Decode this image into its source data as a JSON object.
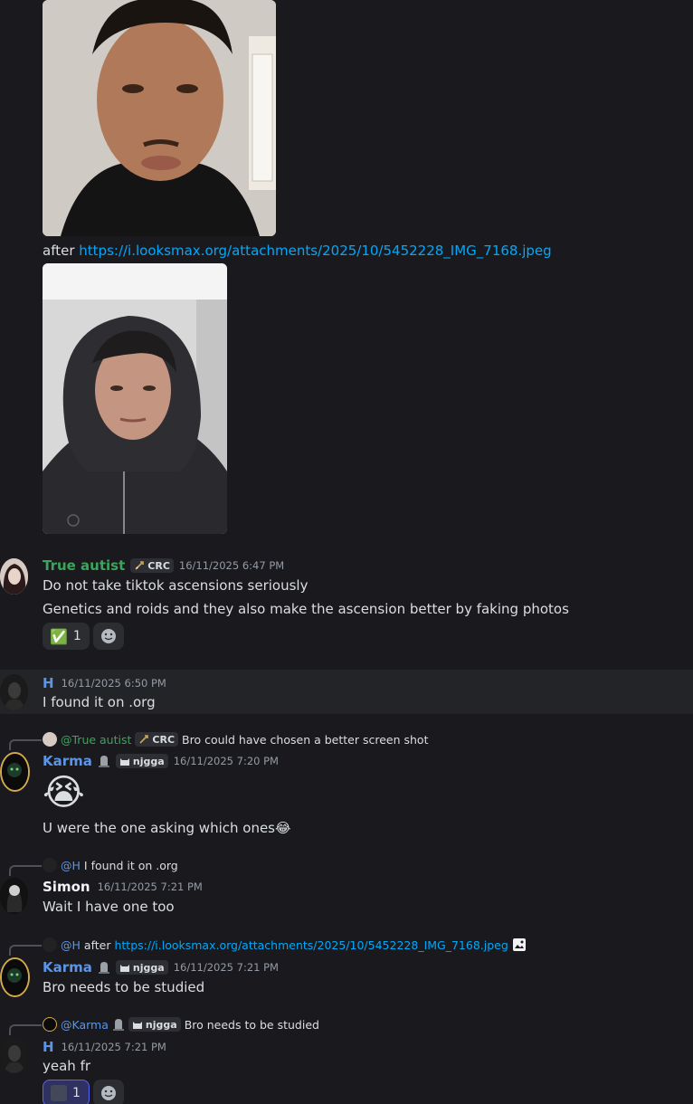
{
  "attachment_link": {
    "prefix": "after",
    "url": "https://i.looksmax.org/attachments/2025/10/5452228_IMG_7168.jpeg"
  },
  "messages": [
    {
      "author": "True autist",
      "author_color": "#3ba55c",
      "badge": "CRC",
      "timestamp": "16/11/2025 6:47 PM",
      "lines": [
        "Do not take tiktok ascensions seriously",
        "Genetics and roids and they also make the ascension better by faking photos"
      ],
      "reaction": {
        "emoji": "✅",
        "count": "1"
      }
    },
    {
      "author": "H",
      "author_color": "#5b95e8",
      "timestamp": "16/11/2025 6:50 PM",
      "lines": [
        "I found it on .org"
      ]
    },
    {
      "reply": {
        "mention": "@True autist",
        "badge": "CRC",
        "text": "Bro could have chosen a better screen shot"
      },
      "author": "Karma",
      "author_color": "#5b95e8",
      "badge": "njgga",
      "timestamp": "16/11/2025 7:20 PM",
      "emoji": "😭",
      "lines": [
        "U were the one asking which ones😂"
      ]
    },
    {
      "reply": {
        "mention": "@H",
        "text": "I found it on .org"
      },
      "author": "Simon",
      "author_color": "#f2f3f5",
      "timestamp": "16/11/2025 7:21 PM",
      "lines": [
        "Wait I have one too"
      ]
    },
    {
      "reply": {
        "mention": "@H",
        "text_prefix": "after",
        "url": "https://i.looksmax.org/attachments/2025/10/5452228_IMG_7168.jpeg"
      },
      "author": "Karma",
      "author_color": "#5b95e8",
      "badge": "njgga",
      "timestamp": "16/11/2025 7:21 PM",
      "lines": [
        "Bro needs to be studied"
      ]
    },
    {
      "reply": {
        "mention": "@Karma",
        "badge": "njgga",
        "text": "Bro needs to be studied"
      },
      "author": "H",
      "author_color": "#5b95e8",
      "timestamp": "16/11/2025 7:21 PM",
      "lines": [
        "yeah fr"
      ],
      "reaction": {
        "count": "1"
      }
    }
  ]
}
